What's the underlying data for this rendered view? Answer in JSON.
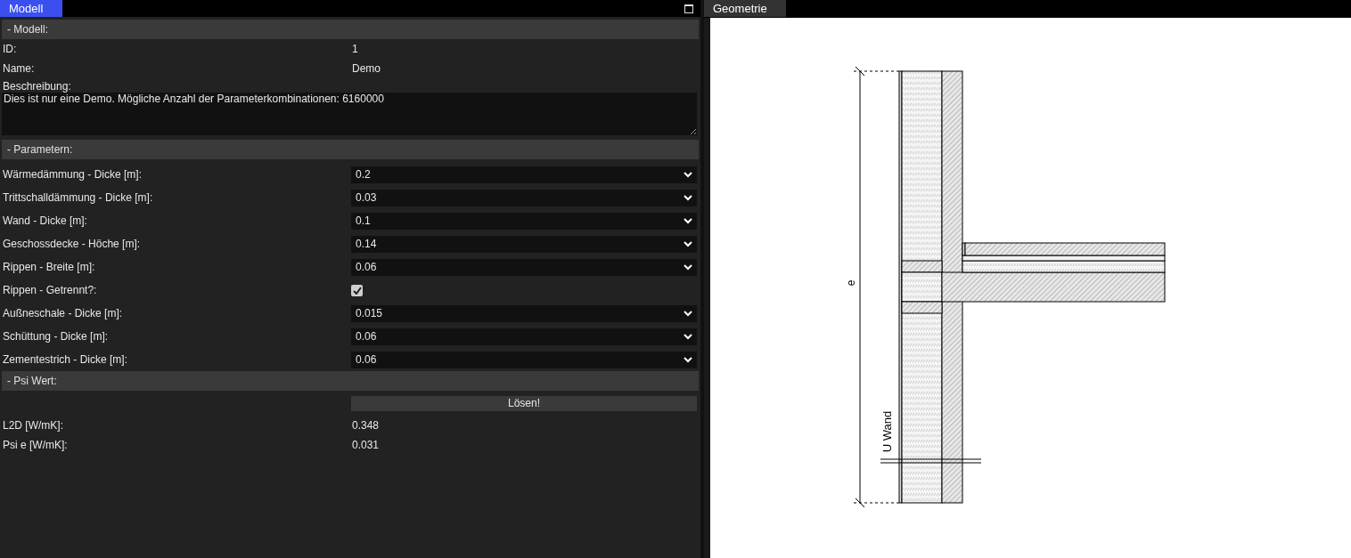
{
  "model_panel": {
    "tab": {
      "label": "Modell",
      "active": true
    },
    "model_section": {
      "header": "- Modell:",
      "fields": [
        {
          "label": "ID:",
          "value": "1"
        },
        {
          "label": "Name:",
          "value": "Demo"
        }
      ],
      "description": {
        "label": "Beschreibung:",
        "value": "Dies ist nur eine Demo. Mögliche Anzahl der Parameterkombinationen: 6160000"
      }
    },
    "parameters_section": {
      "header": "- Parametern:",
      "rows": [
        {
          "kind": "select",
          "label": "Wärmedämmung - Dicke [m]:",
          "value": "0.2"
        },
        {
          "kind": "select",
          "label": "Trittschalldämmung - Dicke [m]:",
          "value": "0.03"
        },
        {
          "kind": "select",
          "label": "Wand - Dicke [m]:",
          "value": "0.1"
        },
        {
          "kind": "select",
          "label": "Geschossdecke - Höche [m]:",
          "value": "0.14"
        },
        {
          "kind": "select",
          "label": "Rippen - Breite [m]:",
          "value": "0.06"
        },
        {
          "kind": "checkbox",
          "label": "Rippen - Getrennt?:",
          "checked": true
        },
        {
          "kind": "select",
          "label": "Außneschale - Dicke [m]:",
          "value": "0.015"
        },
        {
          "kind": "select",
          "label": "Schüttung - Dicke [m]:",
          "value": "0.06"
        },
        {
          "kind": "select",
          "label": "Zementestrich - Dicke [m]:",
          "value": "0.06"
        }
      ]
    },
    "psi_section": {
      "header": "- Psi Wert:",
      "solve_button": "Lösen!",
      "results": [
        {
          "label": "L2D [W/mK]:",
          "value": "0.348"
        },
        {
          "label": "Psi e [W/mK]:",
          "value": "0.031"
        }
      ]
    }
  },
  "geometry_panel": {
    "tab": {
      "label": "Geometrie",
      "active": false
    },
    "dimension_label": "e",
    "wall_label": "U Wand"
  }
}
